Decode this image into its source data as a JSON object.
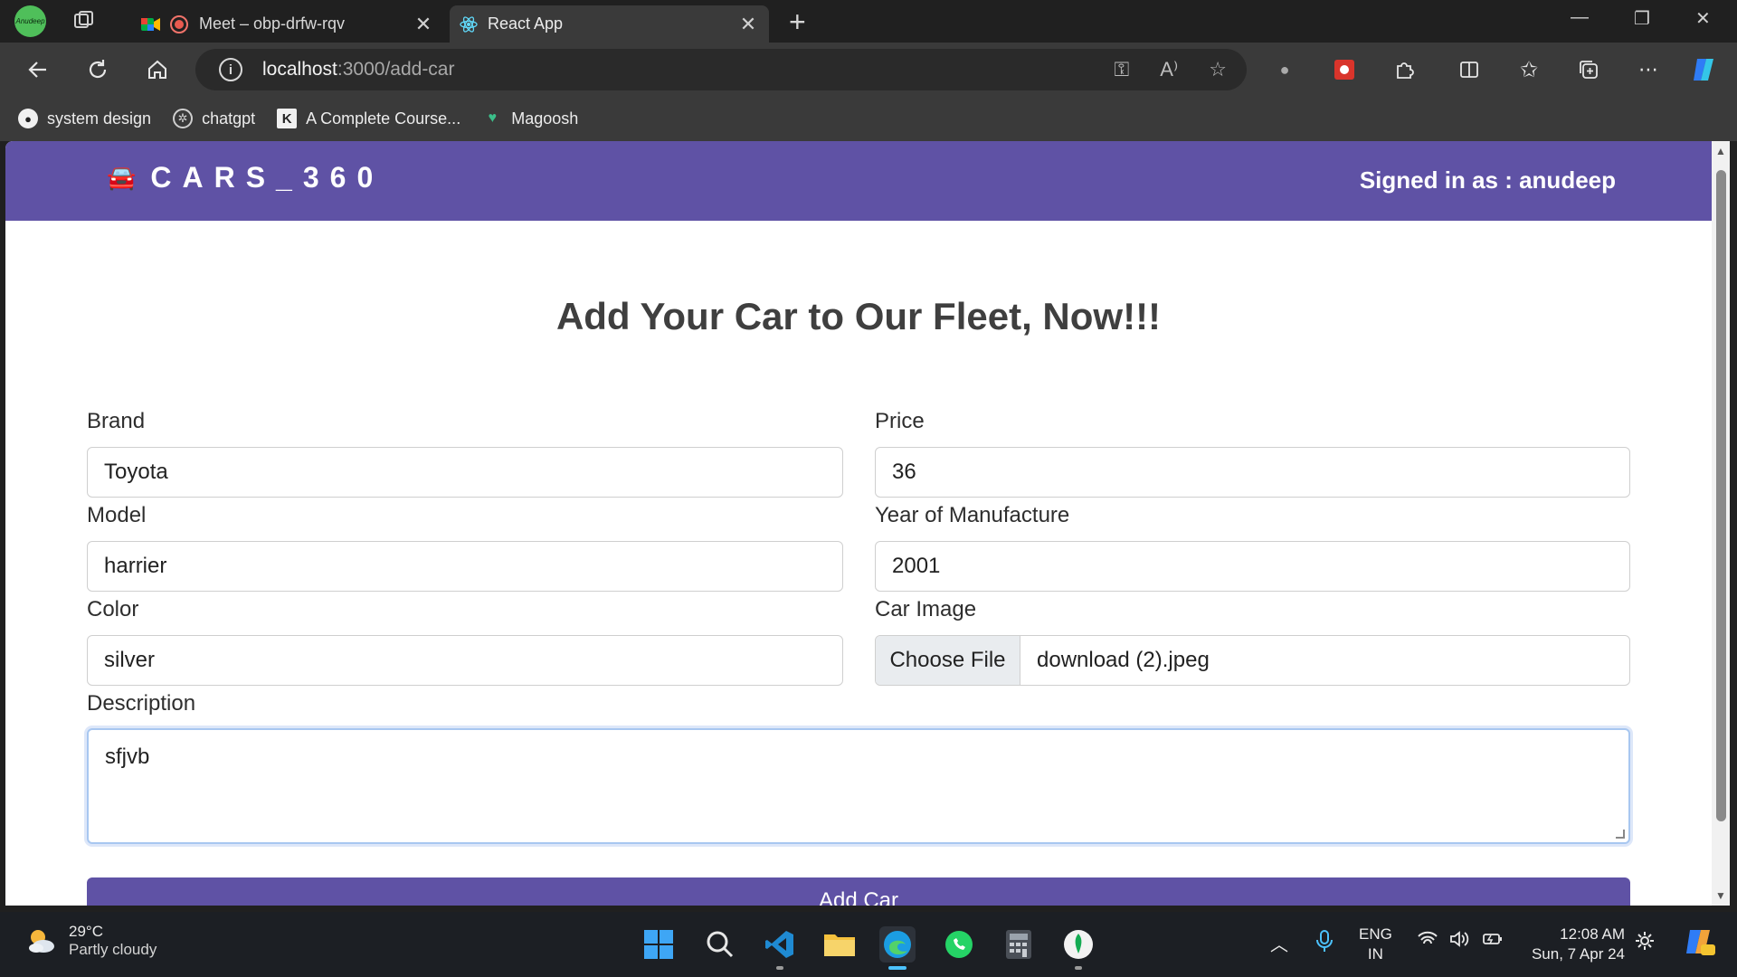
{
  "browser": {
    "profile_initials": "Anudeep",
    "tabs": [
      {
        "title": "Meet – obp-drfw-rqv",
        "close": "✕"
      },
      {
        "title": "React App",
        "close": "✕"
      }
    ],
    "new_tab": "+",
    "address": {
      "host": "localhost",
      "path": ":3000/add-car"
    },
    "bookmarks": [
      {
        "label": "system design",
        "icon": "github-icon"
      },
      {
        "label": "chatgpt",
        "icon": "chatgpt-icon"
      },
      {
        "label": "A Complete Course...",
        "icon": "k-icon"
      },
      {
        "label": "Magoosh",
        "icon": "magoosh-icon"
      }
    ]
  },
  "app": {
    "brand_emoji": "🚘",
    "brand_text": "CARS_360",
    "signed_in": "Signed in as : anudeep",
    "heading": "Add Your Car to Our Fleet, Now!!!",
    "form": {
      "brand_label": "Brand",
      "brand_value": "Toyota",
      "price_label": "Price",
      "price_value": "36",
      "model_label": "Model",
      "model_value": "harrier",
      "year_label": "Year of Manufacture",
      "year_value": "2001",
      "color_label": "Color",
      "color_value": "silver",
      "image_label": "Car Image",
      "choose_file": "Choose File",
      "file_name": "download (2).jpeg",
      "description_label": "Description",
      "description_value": "sfjvb",
      "submit_label": "Add Car"
    },
    "colors": {
      "navbar": "#5f52a5",
      "button": "#5f52a5"
    }
  },
  "taskbar": {
    "weather_temp": "29°C",
    "weather_cond": "Partly cloudy",
    "lang_top": "ENG",
    "lang_bottom": "IN",
    "time": "12:08 AM",
    "date": "Sun, 7 Apr 24"
  }
}
